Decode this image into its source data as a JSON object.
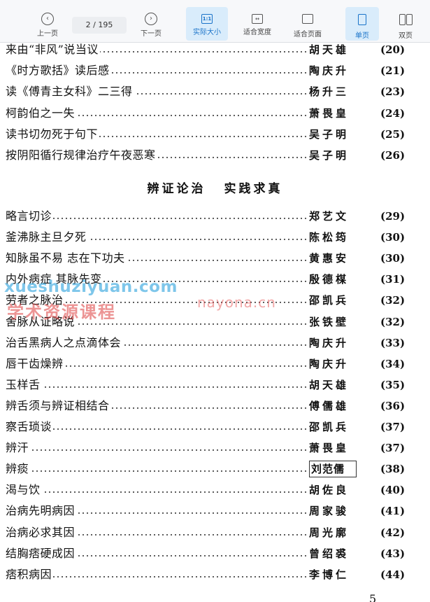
{
  "toolbar": {
    "prev_label": "上一页",
    "next_label": "下一页",
    "page_current": "2",
    "page_total": "/ 195",
    "actual_size_label": "实际大小",
    "actual_size_icon_text": "1:1",
    "fit_width_label": "适合宽度",
    "fit_page_label": "适合页面",
    "single_page_label": "单页",
    "double_page_label": "双页",
    "active_color": "#1a73c9"
  },
  "toc_top": [
    {
      "title": "来由“非风”说当议",
      "author": "胡天雄",
      "page": "(20)"
    },
    {
      "title": "《时方歌括》读后感",
      "author": "陶庆升",
      "page": "(21)"
    },
    {
      "title": "读《傅青主女科》二三得",
      "author": "杨升三",
      "page": "(23)"
    },
    {
      "title": "柯韵伯之一失",
      "author": "萧畏皇",
      "page": "(24)"
    },
    {
      "title": "读书切勿死于句下",
      "author": "吴子明",
      "page": "(25)"
    },
    {
      "title": "按阴阳循行规律治疗午夜恶寒",
      "author": "吴子明",
      "page": "(26)"
    }
  ],
  "section": {
    "part1": "辨证论治",
    "part2": "实践求真"
  },
  "toc_bottom": [
    {
      "title": "略言切诊",
      "author": "郑艺文",
      "page": "(29)"
    },
    {
      "title": "釜沸脉主旦夕死",
      "author": "陈松筠",
      "page": "(30)"
    },
    {
      "title": "知脉虽不易  志在下功夫",
      "author": "黄惠安",
      "page": "(30)"
    },
    {
      "title": "内外病症  其脉先变",
      "author": "殷德楳",
      "page": "(31)"
    },
    {
      "title": "劳者之脉治",
      "author": "邵凯兵",
      "page": "(32)"
    },
    {
      "title": "舍脉从证略说",
      "author": "张铁壁",
      "page": "(32)"
    },
    {
      "title": "治舌黑病人之点滴体会",
      "author": "陶庆升",
      "page": "(33)"
    },
    {
      "title": "唇干齿燥辨",
      "author": "陶庆升",
      "page": "(34)"
    },
    {
      "title": "玉样舌",
      "author": "胡天雄",
      "page": "(35)"
    },
    {
      "title": "辨舌须与辨证相结合",
      "author": "傅儒雄",
      "page": "(36)"
    },
    {
      "title": "察舌琐谈",
      "author": "邵凯兵",
      "page": "(37)"
    },
    {
      "title": "辨汗",
      "author": "萧畏皇",
      "page": "(37)"
    },
    {
      "title": "辨痰",
      "author": "刘范儒",
      "page": "(38)"
    },
    {
      "title": "渴与饮",
      "author": "胡佐良",
      "page": "(40)"
    },
    {
      "title": "治病先明病因",
      "author": "周家骏",
      "page": "(41)"
    },
    {
      "title": "治病必求其因",
      "author": "周光廓",
      "page": "(42)"
    },
    {
      "title": "结胸痞硬成因",
      "author": "曾绍裘",
      "page": "(43)"
    },
    {
      "title": "痞积病因",
      "author": "李博仁",
      "page": "(44)"
    }
  ],
  "watermarks": {
    "w1": "xueshuziyuan.com",
    "w2": "学术资源课程",
    "w3": "nayona.cn"
  },
  "footer": "5"
}
